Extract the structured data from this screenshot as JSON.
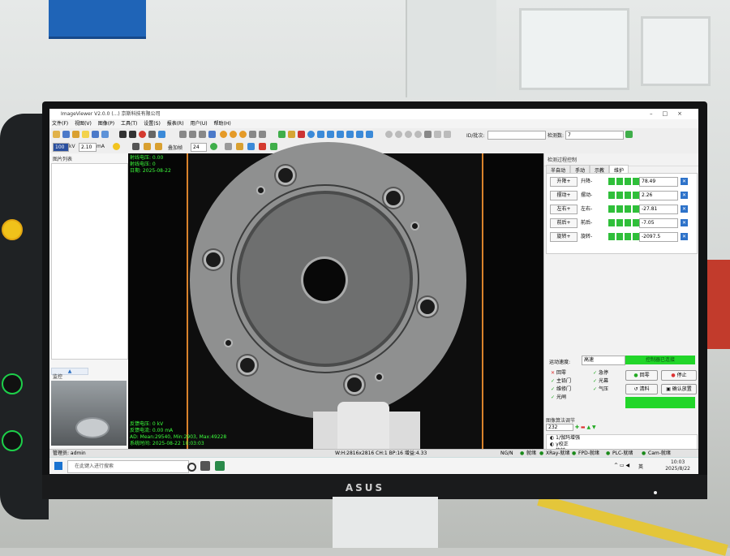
{
  "window": {
    "title": "ImageViewer  V2.0.0 (...) 京斯科技有限公司",
    "menu": [
      "文件(F)",
      "视图(V)",
      "图像(P)",
      "工具(T)",
      "设置(S)",
      "报表(R)",
      "用户(U)",
      "帮助(H)"
    ]
  },
  "toolbar": {
    "id_label": "ID/批次:",
    "id_value": "",
    "count_label": "检测数:",
    "count_value": "7",
    "kv_value": "100",
    "kv_unit": "kV",
    "ma_value": "2.10",
    "ma_unit": "mA",
    "frame_label": "叠加帧",
    "frame_value": "24"
  },
  "left_panel": {
    "title": "图片列表",
    "up_arrow": "▲",
    "down_arrow": "▼",
    "camera_title": "监控"
  },
  "viewer": {
    "overlay_top": [
      "射线电压: 0.00",
      "射线电压: 0",
      "日期: 2025-08-22"
    ],
    "overlay_bottom": [
      "反馈电压: 0 kV",
      "反馈电流: 0.00 mA",
      "AD: Mean:29540, Min:2903, Max:49228",
      "系统时间: 2025-08-22 10:03:03"
    ]
  },
  "right_panel": {
    "title": "检测过程控制",
    "tabs": [
      "半自动",
      "手动",
      "示教",
      "维护"
    ],
    "active_tab": "维护",
    "axes": [
      {
        "button": "升降+",
        "label": "升降-",
        "value": "78.49"
      },
      {
        "button": "摆动+",
        "label": "摆动-",
        "value": "2.26"
      },
      {
        "button": "左右+",
        "label": "左右-",
        "value": "-27.81"
      },
      {
        "button": "前后+",
        "label": "前后-",
        "value": "-7.05"
      },
      {
        "button": "旋转+",
        "label": "旋转-",
        "value": "-2097.5"
      }
    ],
    "speed_label": "运动速度:",
    "speed_value": "高速",
    "controller_status": "控制器已连接",
    "flags_left": [
      "回零",
      "主铅门",
      "维修门",
      "光闸"
    ],
    "flags_right": [
      "急停",
      "光幕",
      "气压"
    ],
    "btn_home": "回零",
    "btn_stop": "停止",
    "btn_clear": "清料",
    "btn_confirm": "确认放置",
    "algo_title": "图像算法调节",
    "algo_value": "232",
    "algo_items": [
      "1/伽玛增强",
      "γ校正",
      "旋转",
      "反色"
    ]
  },
  "statusbar": {
    "user": "管理员: admin",
    "image_info": "W:H:2816x2816 CH:1 BP:16 增益:4.33",
    "indicators": [
      "NG/N",
      "就绪",
      "XRay-就绪",
      "FPD-就绪",
      "PLC-就绪",
      "Cam-就绪"
    ]
  },
  "taskbar": {
    "search_placeholder": "在此键入进行搜索",
    "ime": "英",
    "time": "10:03",
    "date": "2025/8/22"
  },
  "monitor_brand": "ASUS"
}
